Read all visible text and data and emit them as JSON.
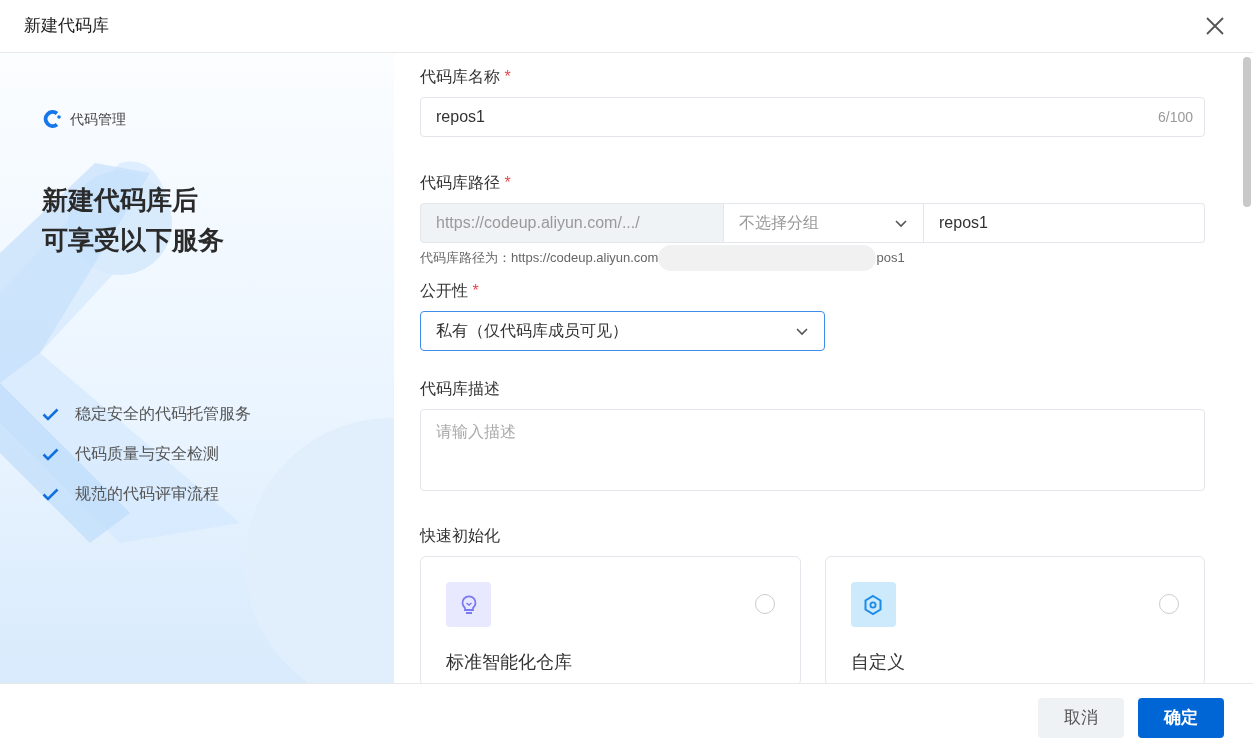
{
  "dialog": {
    "title": "新建代码库"
  },
  "promo": {
    "brand": "代码管理",
    "headline": [
      "新建代码库后",
      "可享受以下服务"
    ],
    "features": [
      "稳定安全的代码托管服务",
      "代码质量与安全检测",
      "规范的代码评审流程"
    ]
  },
  "form": {
    "name": {
      "label": "代码库名称",
      "required_mark": "*",
      "value": "repos1",
      "counter": "6/100"
    },
    "path": {
      "label": "代码库路径",
      "required_mark": "*",
      "prefix": "https://codeup.aliyun.com/.../",
      "group_placeholder": "不选择分组",
      "value": "repos1",
      "hint_start": "代码库路径为：https://codeup.aliyun.com",
      "hint_end": "pos1"
    },
    "visibility": {
      "label": "公开性",
      "required_mark": "*",
      "value": "私有（仅代码库成员可见）",
      "focused": true
    },
    "description": {
      "label": "代码库描述",
      "placeholder": "请输入描述"
    },
    "init": {
      "label": "快速初始化",
      "options": [
        {
          "kind": "bulb",
          "title": "标准智能化仓库",
          "selected": false
        },
        {
          "kind": "hex",
          "title": "自定义",
          "selected": false
        }
      ]
    }
  },
  "buttons": [
    {
      "kind": "secondary",
      "label": "取消"
    },
    {
      "kind": "primary",
      "label": "确定"
    }
  ]
}
